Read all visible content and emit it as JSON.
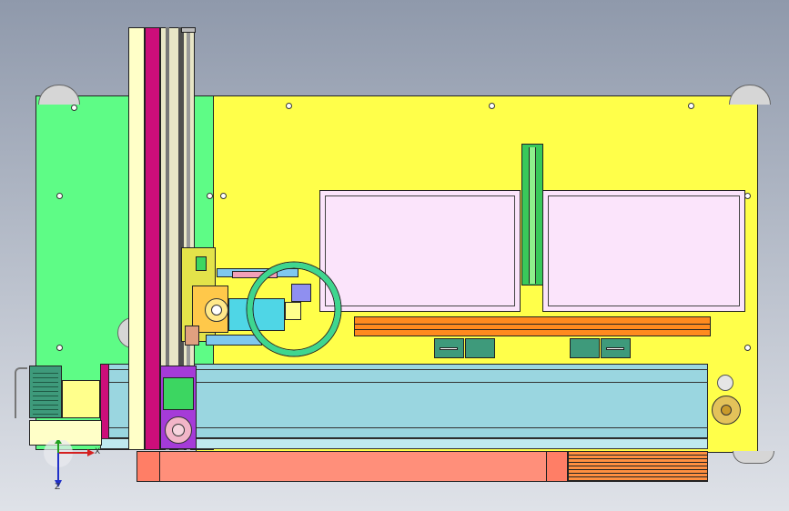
{
  "viewport": {
    "background_top": "#8f99ab",
    "background_bottom": "#dfe2e8"
  },
  "colors": {
    "base_plate": "#ffff4a",
    "left_panel": "#5efc86",
    "window_fill": "#fbe4fb",
    "rail_orange": "#ff8a1e",
    "pink_beam": "#cc0e7a",
    "purple_carriage": "#a53bd8",
    "cyan_ring": "#3ed68f",
    "blue_rail": "#9ad6e0",
    "salmon_base": "#ff8f7a",
    "motor_green": "#3e9a7b"
  },
  "triad": {
    "x_label": "X",
    "y_label": "",
    "z_label": "Z"
  },
  "icons": {
    "triad": "coordinate-triad-icon",
    "fasteners": "hex-bolt-icon",
    "motor": "servo-motor-icon"
  }
}
